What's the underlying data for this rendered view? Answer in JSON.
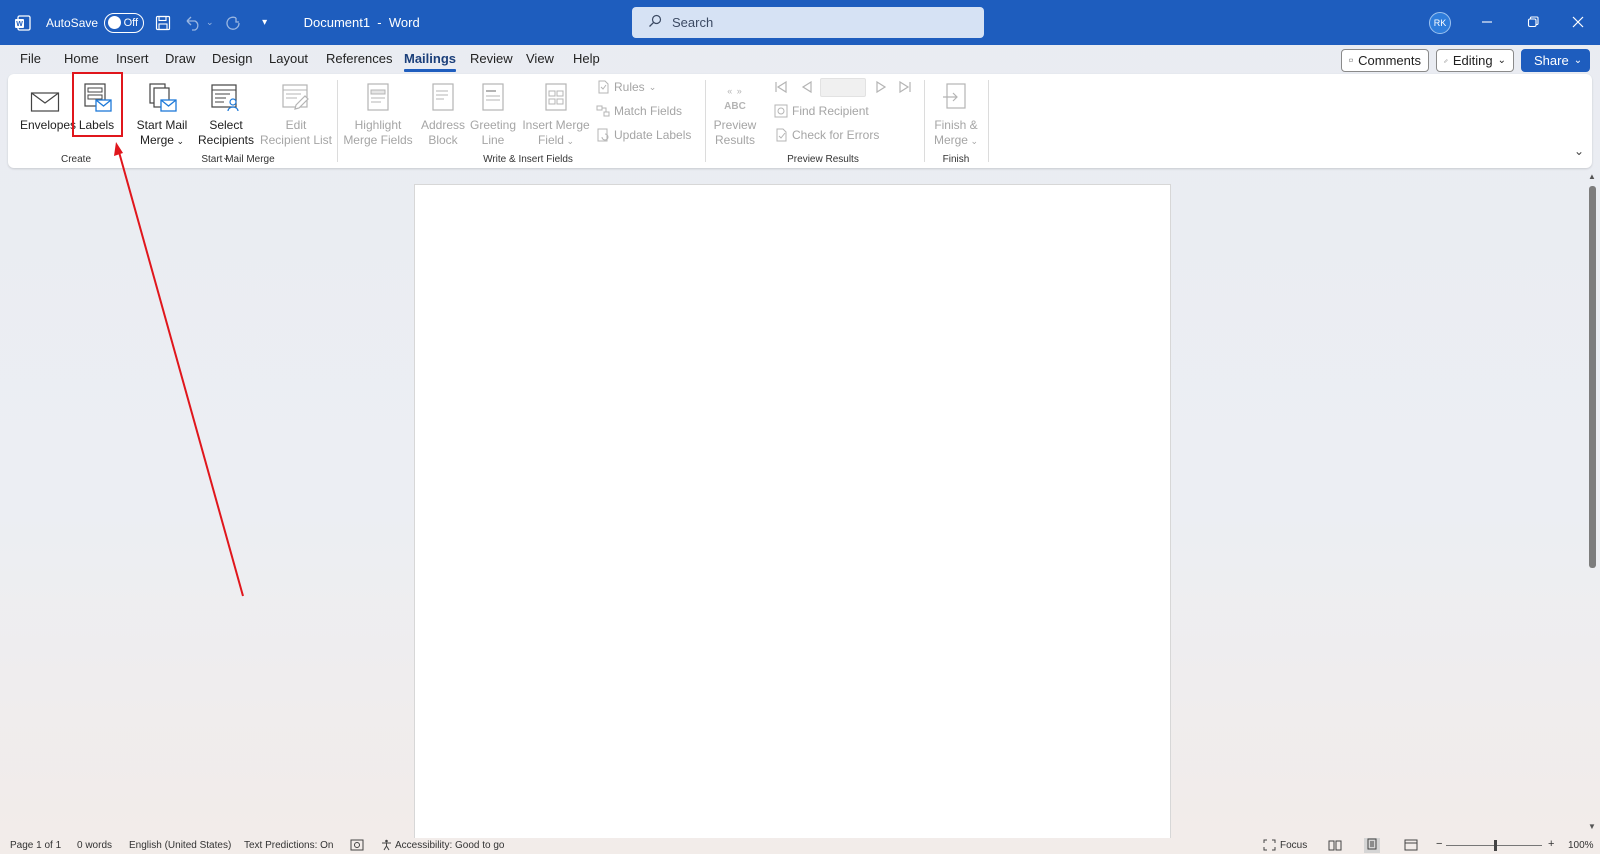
{
  "titlebar": {
    "autosave_label": "AutoSave",
    "toggle_state": "Off",
    "doc_title": "Document1  -  Word",
    "search_placeholder": "Search",
    "avatar_initials": "RK",
    "accent_color": "#1e5dbe"
  },
  "menu": {
    "tabs": [
      "File",
      "Home",
      "Insert",
      "Draw",
      "Design",
      "Layout",
      "References",
      "Mailings",
      "Review",
      "View",
      "Help"
    ],
    "active_tab": "Mailings",
    "comments_label": "Comments",
    "editing_label": "Editing",
    "share_label": "Share"
  },
  "ribbon": {
    "create": {
      "group_label": "Create",
      "envelopes": "Envelopes",
      "labels": "Labels"
    },
    "start_mail_merge": {
      "group_label": "Start Mail Merge",
      "start_line1": "Start Mail",
      "start_line2": "Merge",
      "select_line1": "Select",
      "select_line2": "Recipients",
      "edit_line1": "Edit",
      "edit_line2": "Recipient List"
    },
    "write_insert": {
      "group_label": "Write & Insert Fields",
      "highlight_line1": "Highlight",
      "highlight_line2": "Merge Fields",
      "address_line1": "Address",
      "address_line2": "Block",
      "greeting_line1": "Greeting",
      "greeting_line2": "Line",
      "insert_line1": "Insert Merge",
      "insert_line2": "Field",
      "rules": "Rules",
      "match_fields": "Match Fields",
      "update_labels": "Update Labels"
    },
    "preview": {
      "group_label": "Preview Results",
      "preview_line1": "Preview",
      "preview_line2": "Results",
      "abc_icon_text": "ABC",
      "find_recipient": "Find Recipient",
      "check_errors": "Check for Errors"
    },
    "finish": {
      "group_label": "Finish",
      "finish_line1": "Finish &",
      "finish_line2": "Merge"
    }
  },
  "statusbar": {
    "page": "Page 1 of 1",
    "words": "0 words",
    "language": "English (United States)",
    "text_predictions": "Text Predictions: On",
    "accessibility": "Accessibility: Good to go",
    "focus": "Focus",
    "zoom": "100%"
  },
  "annotation": {
    "highlight_color": "#e0161c"
  }
}
